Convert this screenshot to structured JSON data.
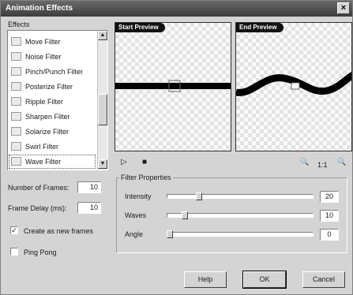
{
  "window": {
    "title": "Animation Effects",
    "close_glyph": "×"
  },
  "effects": {
    "label": "Effects",
    "items": [
      {
        "label": "Move Filter"
      },
      {
        "label": "Noise Filter"
      },
      {
        "label": "Pinch/Punch Filter"
      },
      {
        "label": "Posterize Filter"
      },
      {
        "label": "Ripple Filter"
      },
      {
        "label": "Sharpen Filter"
      },
      {
        "label": "Solarize Filter"
      },
      {
        "label": "Swirl Filter"
      },
      {
        "label": "Wave Filter"
      }
    ],
    "selected": "Wave Filter",
    "scroll_up_glyph": "▲",
    "scroll_down_glyph": "▼"
  },
  "frames": {
    "number_label": "Number of Frames:",
    "number_value": "10",
    "delay_label": "Frame Delay (ms):",
    "delay_value": "10",
    "create_new_label": "Create as new frames",
    "create_new_checked": true,
    "ping_pong_label": "Ping Pong",
    "ping_pong_checked": false,
    "check_glyph": "✓"
  },
  "previews": {
    "start_label": "Start Preview",
    "end_label": "End Preview"
  },
  "playback": {
    "play_glyph": "▷",
    "stop_glyph": "■",
    "zoom_in_glyph": "🔍",
    "zoom_level": "1:1",
    "zoom_out_glyph": "🔍"
  },
  "filter_properties": {
    "label": "Filter Properties",
    "properties": [
      {
        "label": "Intensity",
        "value": "20",
        "level": 0.2
      },
      {
        "label": "Waves",
        "value": "10",
        "level": 0.1
      },
      {
        "label": "Angle",
        "value": "0",
        "level": 0.0
      }
    ]
  },
  "buttons": {
    "help": "Help",
    "ok": "OK",
    "cancel": "Cancel"
  },
  "colors": {
    "titlebar": "#3c3c3c",
    "dialog_bg": "#d4d4d4",
    "preview_tag": "#111111"
  }
}
